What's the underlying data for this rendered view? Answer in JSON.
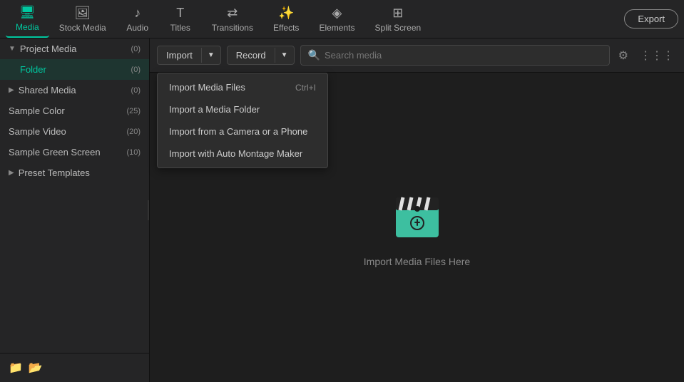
{
  "topNav": {
    "items": [
      {
        "id": "media",
        "label": "Media",
        "icon": "🖥",
        "active": true
      },
      {
        "id": "stock-media",
        "label": "Stock Media",
        "icon": "🖼",
        "active": false
      },
      {
        "id": "audio",
        "label": "Audio",
        "icon": "♪",
        "active": false
      },
      {
        "id": "titles",
        "label": "Titles",
        "icon": "T",
        "active": false
      },
      {
        "id": "transitions",
        "label": "Transitions",
        "icon": "⇄",
        "active": false
      },
      {
        "id": "effects",
        "label": "Effects",
        "icon": "✨",
        "active": false
      },
      {
        "id": "elements",
        "label": "Elements",
        "icon": "◈",
        "active": false
      },
      {
        "id": "split-screen",
        "label": "Split Screen",
        "icon": "⊞",
        "active": false
      }
    ],
    "exportLabel": "Export"
  },
  "sidebar": {
    "sections": [
      {
        "id": "project-media",
        "label": "Project Media",
        "count": "(0)",
        "expanded": true,
        "children": [
          {
            "id": "folder",
            "label": "Folder",
            "count": "(0)",
            "selected": true
          }
        ]
      },
      {
        "id": "shared-media",
        "label": "Shared Media",
        "count": "(0)",
        "expanded": false,
        "children": []
      },
      {
        "id": "sample-color",
        "label": "Sample Color",
        "count": "(25)",
        "indent": true
      },
      {
        "id": "sample-video",
        "label": "Sample Video",
        "count": "(20)",
        "indent": true
      },
      {
        "id": "sample-green-screen",
        "label": "Sample Green Screen",
        "count": "(10)",
        "indent": true
      },
      {
        "id": "preset-templates",
        "label": "Preset Templates",
        "count": "",
        "expanded": false,
        "children": []
      }
    ],
    "footerButtons": [
      "➕",
      "📁"
    ]
  },
  "toolbar": {
    "importLabel": "Import",
    "recordLabel": "Record",
    "searchPlaceholder": "Search media",
    "filterIcon": "filter",
    "gridIcon": "grid"
  },
  "dropdown": {
    "visible": true,
    "items": [
      {
        "id": "import-media-files",
        "label": "Import Media Files",
        "shortcut": "Ctrl+I"
      },
      {
        "id": "import-media-folder",
        "label": "Import a Media Folder",
        "shortcut": ""
      },
      {
        "id": "import-camera-phone",
        "label": "Import from a Camera or a Phone",
        "shortcut": ""
      },
      {
        "id": "import-auto-montage",
        "label": "Import with Auto Montage Maker",
        "shortcut": ""
      }
    ]
  },
  "mediaContent": {
    "emptyHint": "Import Media Files Here"
  }
}
